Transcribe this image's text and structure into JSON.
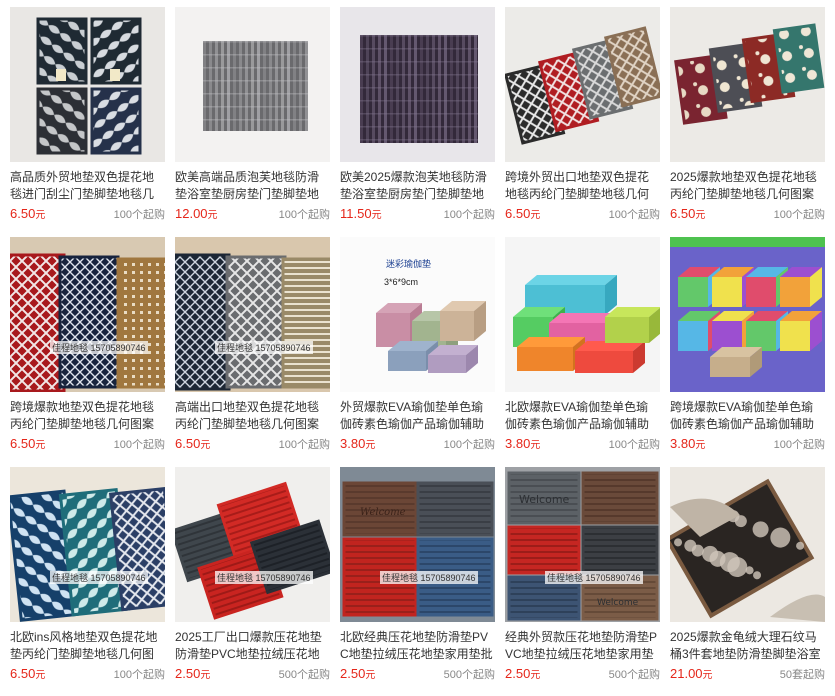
{
  "products": [
    {
      "title": "高品质外贸地垫双色提花地毯进门刮尘门垫脚垫地毯几何图案",
      "price": "6.50",
      "unit": "元",
      "moq": "100个起购",
      "img": "grey-leaf-mats"
    },
    {
      "title": "欧美高端品质泡芙地毯防滑垫浴室垫厨房垫门垫脚垫地毯",
      "price": "12.00",
      "unit": "元",
      "moq": "100个起购",
      "img": "grey-shag-rug"
    },
    {
      "title": "欧美2025爆款泡芙地毯防滑垫浴室垫厨房垫门垫脚垫地毯",
      "price": "11.50",
      "unit": "元",
      "moq": "100个起购",
      "img": "purple-shag-rug"
    },
    {
      "title": "跨境外贸出口地垫双色提花地毯丙纶门垫脚垫地毯几何图案",
      "price": "6.50",
      "unit": "元",
      "moq": "100个起购",
      "img": "lattice-mats"
    },
    {
      "title": "2025爆款地垫双色提花地毯丙纶门垫脚垫地毯几何图案",
      "price": "6.50",
      "unit": "元",
      "moq": "100个起购",
      "img": "floral-mats"
    },
    {
      "title": "跨境爆款地垫双色提花地毯丙纶门垫脚垫地毯几何图案防滑",
      "price": "6.50",
      "unit": "元",
      "moq": "100个起购",
      "img": "red-navy-mats",
      "watermark": "佳程地毯 15705890746"
    },
    {
      "title": "高端出口地垫双色提花地毯丙纶门垫脚垫地毯几何图案防滑",
      "price": "6.50",
      "unit": "元",
      "moq": "100个起购",
      "img": "navy-grey-mats",
      "watermark": "佳程地毯 15705890746"
    },
    {
      "title": "外贸爆款EVA瑜伽垫单色瑜伽砖素色瑜伽产品瑜伽辅助砖",
      "price": "3.80",
      "unit": "元",
      "moq": "100个起购",
      "img": "marble-yoga-blocks",
      "label1": "迷彩瑜伽垫",
      "label2": "3*6*9cm"
    },
    {
      "title": "北欧爆款EVA瑜伽垫单色瑜伽砖素色瑜伽产品瑜伽辅助砖",
      "price": "3.80",
      "unit": "元",
      "moq": "100个起购",
      "img": "color-yoga-blocks"
    },
    {
      "title": "跨境爆款EVA瑜伽垫单色瑜伽砖素色瑜伽产品瑜伽辅助砖",
      "price": "3.80",
      "unit": "元",
      "moq": "100个起购",
      "img": "striped-yoga-blocks"
    },
    {
      "title": "北欧ins风格地垫双色提花地垫丙纶门垫脚垫地毯几何图案",
      "price": "6.50",
      "unit": "元",
      "moq": "100个起购",
      "img": "blue-pattern-mats",
      "watermark": "佳程地毯 15705890746"
    },
    {
      "title": "2025工厂出口爆款压花地垫防滑垫PVC地垫拉绒压花地垫",
      "price": "2.50",
      "unit": "元",
      "moq": "500个起购",
      "img": "red-pvc-mats",
      "watermark": "佳程地毯 15705890746"
    },
    {
      "title": "北欧经典压花地垫防滑垫PVC地垫拉绒压花地垫家用垫批发",
      "price": "2.50",
      "unit": "元",
      "moq": "500个起购",
      "img": "welcome-mats-brown",
      "watermark": "佳程地毯 15705890746"
    },
    {
      "title": "经典外贸款压花地垫防滑垫PVC地垫拉绒压花地垫家用垫",
      "price": "2.50",
      "unit": "元",
      "moq": "500个起购",
      "img": "welcome-mats-grey",
      "watermark": "佳程地毯 15705890746"
    },
    {
      "title": "2025爆款金龟绒大理石纹马桶3件套地垫防滑垫脚垫浴室",
      "price": "21.00",
      "unit": "元",
      "moq": "50套起购",
      "img": "marble-bath-set"
    }
  ]
}
